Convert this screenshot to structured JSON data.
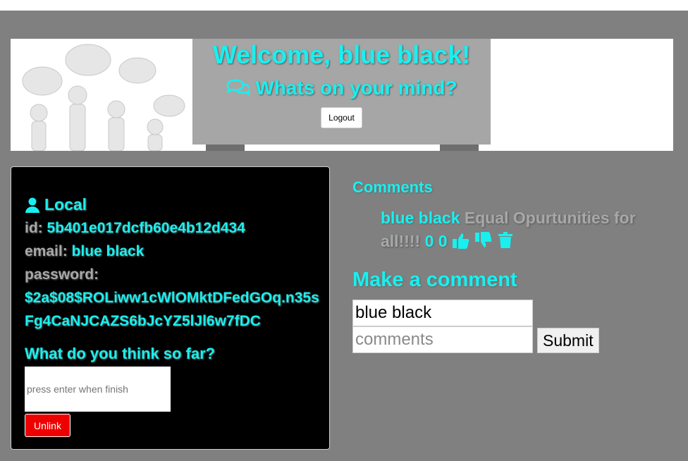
{
  "header": {
    "title": "Welcome, blue black!",
    "subtitle": "Whats on your mind?",
    "logout_label": "Logout"
  },
  "profile": {
    "heading": "Local",
    "id_label": "id:",
    "id_value": "5b401e017dcfb60e4b12d434",
    "email_label": "email:",
    "email_value": "blue black",
    "password_label": "password:",
    "password_value": "$2a$08$ROLiww1cWlOMktDFedGOq.n35sFg4CaNJCAZS6bJcYZ5lJl6w7fDC",
    "prompt": "What do you think so far?",
    "input_placeholder": "press enter when finish",
    "unlink_label": "Unlink"
  },
  "comments": {
    "heading": "Comments",
    "items": [
      {
        "author": "blue black",
        "text": "Equal Opurtunities for all!!!!",
        "likes": "0",
        "dislikes": "0"
      }
    ],
    "make_heading": "Make a comment",
    "name_value": "blue black",
    "comment_placeholder": "comments",
    "submit_label": "Submit"
  },
  "colors": {
    "accent": "#18f0f0",
    "background": "#808080",
    "danger": "#ee0000"
  }
}
